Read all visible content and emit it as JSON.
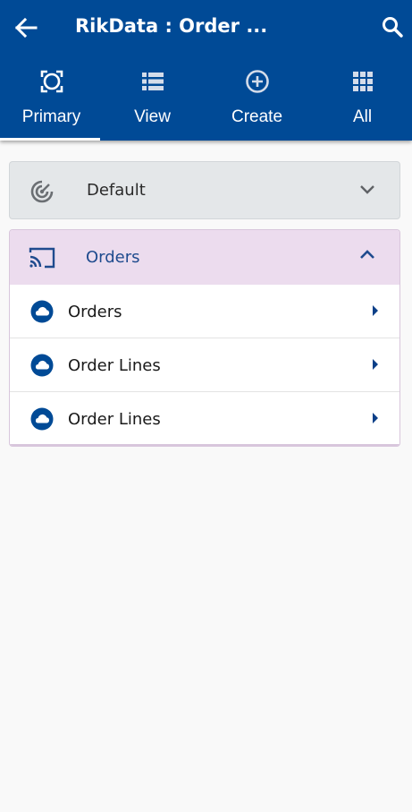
{
  "header": {
    "title": "RikData : Order ...",
    "back_icon": "arrow-left-icon",
    "search_icon": "search-icon",
    "background": "#004a96"
  },
  "tabs": [
    {
      "label": "Primary",
      "icon": "focus-frame-icon",
      "selected": true
    },
    {
      "label": "View",
      "icon": "list-view-icon",
      "selected": false
    },
    {
      "label": "Create",
      "icon": "plus-circle-icon",
      "selected": false
    },
    {
      "label": "All",
      "icon": "grid-apps-icon",
      "selected": false
    }
  ],
  "panels": {
    "default": {
      "label": "Default",
      "icon": "radar-icon",
      "expanded": false
    },
    "orders": {
      "label": "Orders",
      "icon": "cast-icon",
      "expanded": true,
      "items": [
        {
          "label": "Orders",
          "icon": "cloud-icon"
        },
        {
          "label": "Order Lines",
          "icon": "cloud-icon"
        },
        {
          "label": "Order Lines",
          "icon": "cloud-icon"
        }
      ]
    }
  },
  "colors": {
    "primary": "#004a96",
    "accent_text": "#1f4b8e",
    "expanded_header_bg": "#ecdcee",
    "collapsed_panel_bg": "#e4e7e9"
  }
}
